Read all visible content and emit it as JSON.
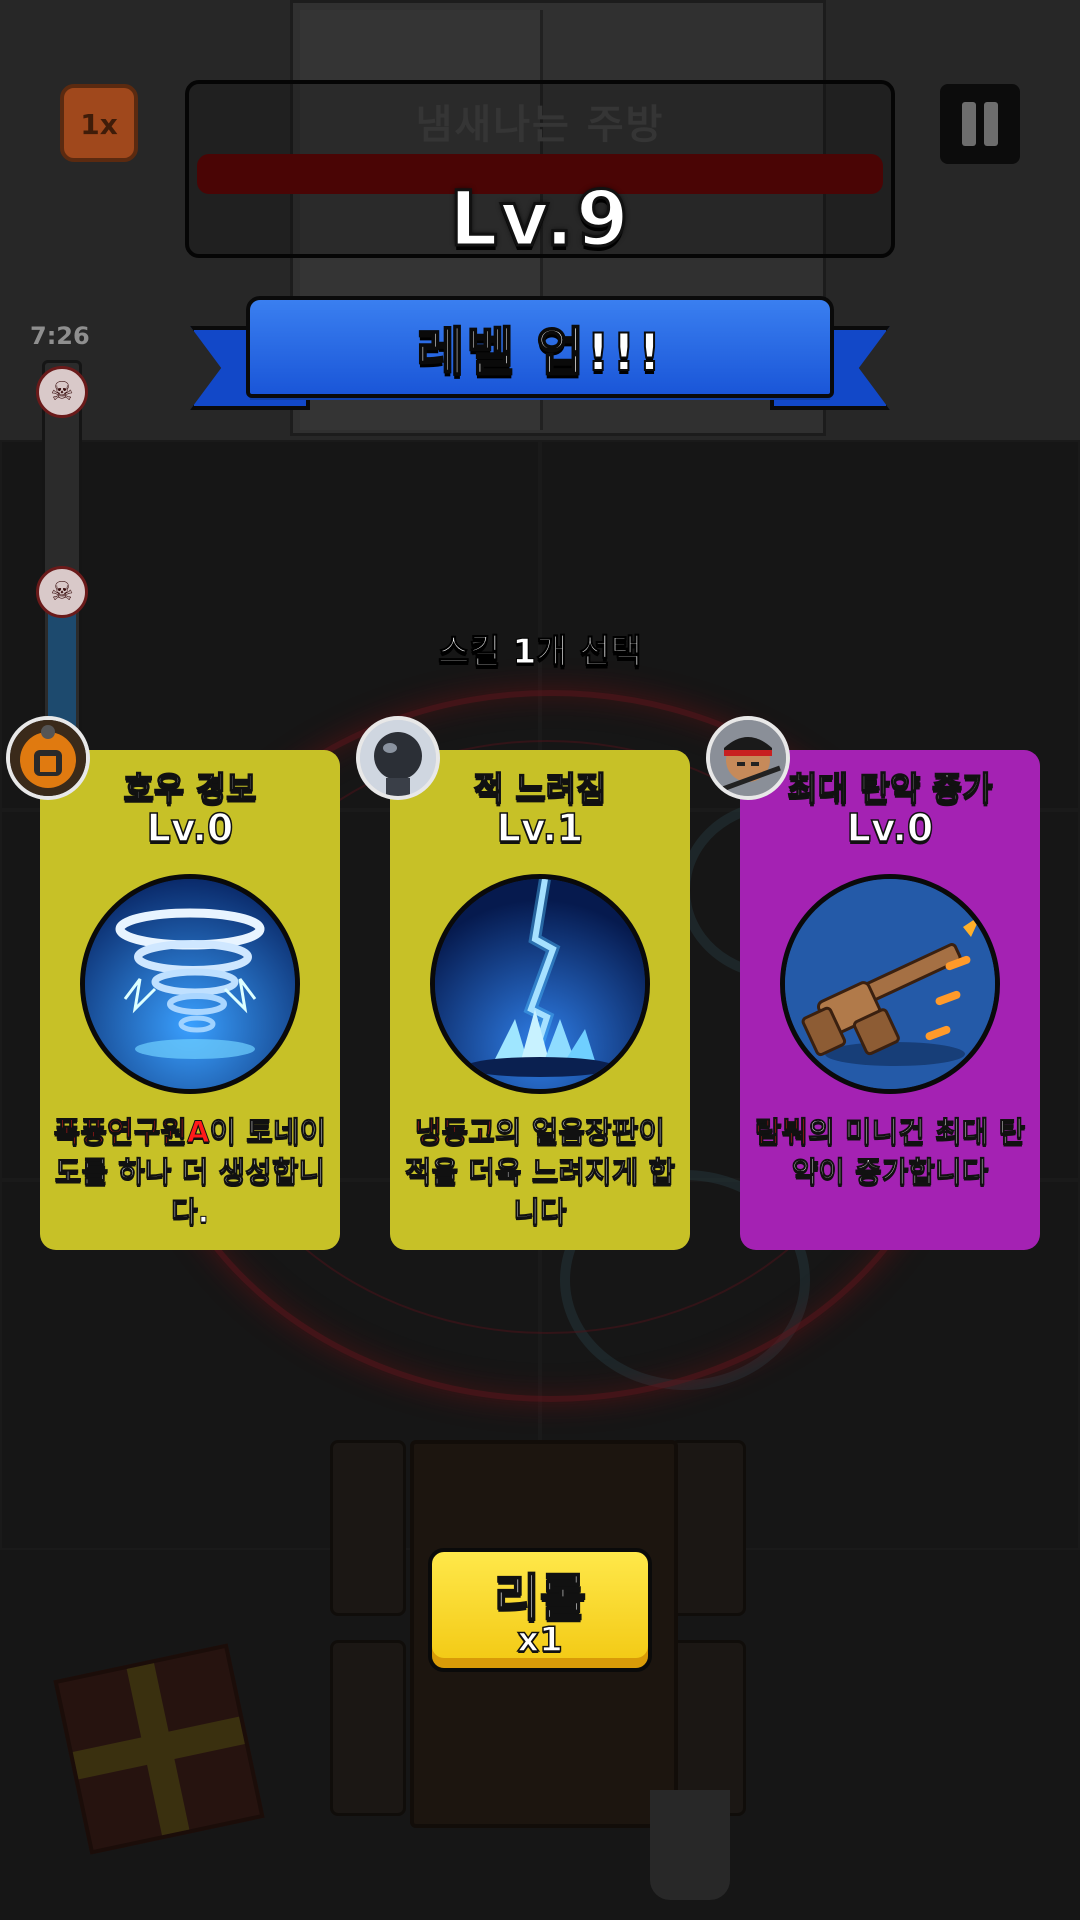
{
  "hud": {
    "speed_label": "1x",
    "stage_name": "냄새나는 주방",
    "timer": "7:26"
  },
  "level": {
    "text": "Lv.9",
    "banner": "레벨 업!!!"
  },
  "selection": {
    "prompt": "스킬 1개 선택"
  },
  "cards": [
    {
      "title": "호우 경보",
      "level": "Lv.0",
      "icon": "tornado-icon",
      "avatar": "hazmat-researcher-avatar",
      "highlight": "폭풍연구원A",
      "desc_after": "이 토네이도를 하나 더 생성합니다.",
      "color": "#c7c127"
    },
    {
      "title": "적 느려짐",
      "level": "Lv.1",
      "icon": "ice-lightning-icon",
      "avatar": "freezer-robot-avatar",
      "highlight": "냉동고",
      "desc_after": "의 얼음장판이 적을 더욱 느려지게 합니다",
      "color": "#c7c127"
    },
    {
      "title": "최대 탄약 증가",
      "level": "Lv.0",
      "icon": "minigun-icon",
      "avatar": "rambo-soldier-avatar",
      "highlight": "람붜",
      "desc_after": "의 미니건 최대 탄약이 증가합니다",
      "color": "#a422b3"
    }
  ],
  "reroll": {
    "label": "리롤",
    "count": "x1"
  },
  "colors": {
    "banner_blue": "#1a56d8",
    "card_yellow": "#c7c127",
    "card_purple": "#a422b3",
    "highlight_red": "#ff1a1a",
    "reroll_yellow": "#f2c812"
  }
}
